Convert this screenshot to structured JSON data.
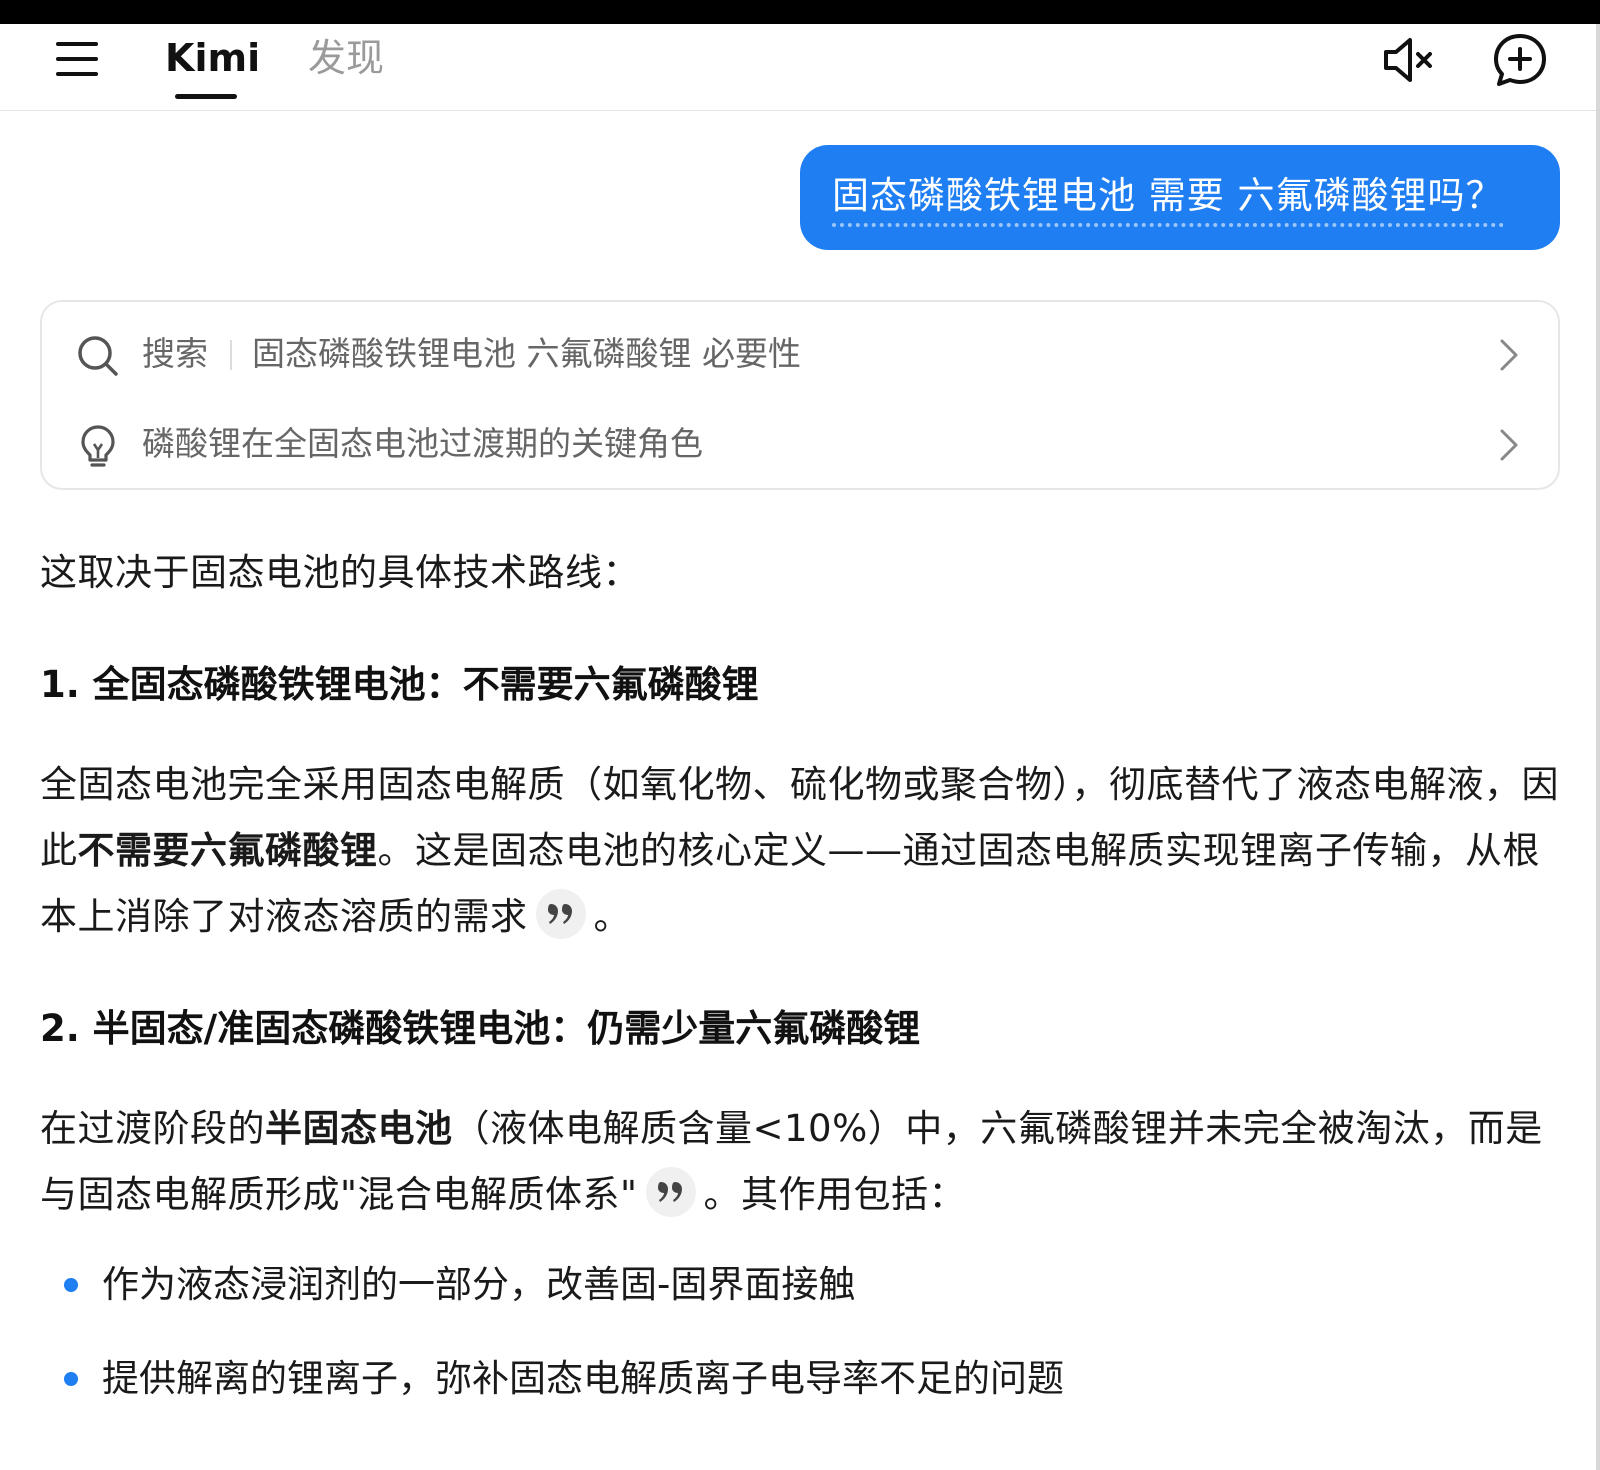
{
  "header": {
    "tabs": [
      {
        "label": "Kimi",
        "active": true
      },
      {
        "label": "发现",
        "active": false
      }
    ]
  },
  "user_message": "固态磷酸铁锂电池 需要 六氟磷酸锂吗？",
  "search_card": {
    "search_label": "搜索",
    "search_query": "固态磷酸铁锂电池 六氟磷酸锂 必要性",
    "insight": "磷酸锂在全固态电池过渡期的关键角色"
  },
  "answer": {
    "intro": "这取决于固态电池的具体技术路线：",
    "section1": {
      "heading": "1. 全固态磷酸铁锂电池：不需要六氟磷酸锂",
      "p_a": "全固态电池完全采用固态电解质（如氧化物、硫化物或聚合物），彻底替代了液态电解液，因此",
      "p_b": "不需要六氟磷酸锂",
      "p_c": "。这是固态电池的核心定义——通过固态电解质实现锂离子传输，从根本上消除了对液态溶质的需求",
      "p_d": "。"
    },
    "section2": {
      "heading": "2. 半固态/准固态磷酸铁锂电池：仍需少量六氟磷酸锂",
      "p_a": "在过渡阶段的",
      "p_b": "半固态电池",
      "p_c": "（液体电解质含量<10%）中，六氟磷酸锂并未完全被淘汰，而是与固态电解质形成\"混合电解质体系\"",
      "p_d": "。其作用包括：",
      "bullets": [
        "作为液态浸润剂的一部分，改善固-固界面接触",
        "提供解离的锂离子，弥补固态电解质离子电导率不足的问题"
      ]
    }
  },
  "colors": {
    "accent": "#1e7ef2",
    "text": "#1a1a1a",
    "muted": "#666666"
  },
  "icons": [
    "menu-icon",
    "mute-icon",
    "new-chat-icon",
    "search-icon",
    "lightbulb-icon",
    "chevron-right-icon",
    "quote-icon"
  ]
}
